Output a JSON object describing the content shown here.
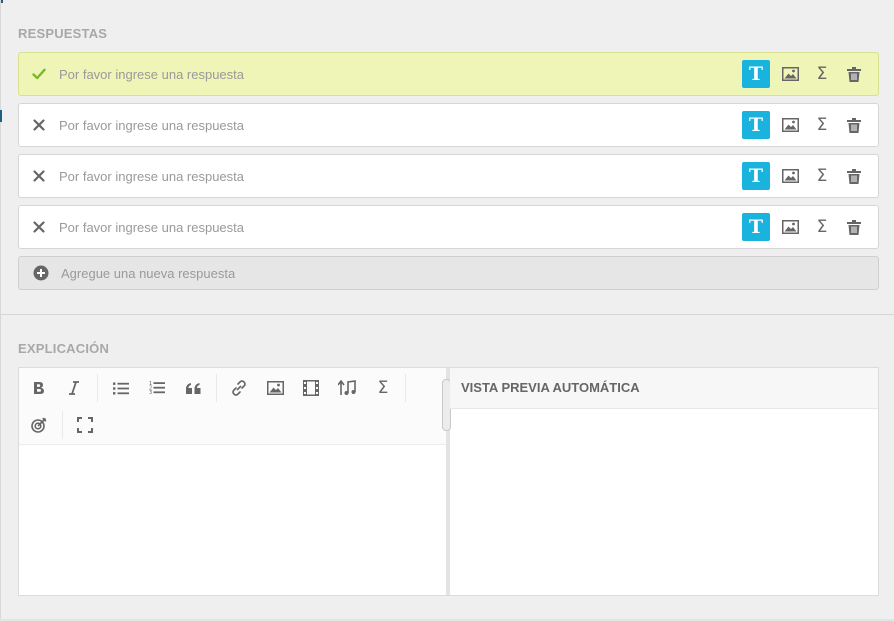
{
  "respuestas": {
    "title": "RESPUESTAS",
    "placeholder": "Por favor ingrese una respuesta",
    "items": [
      {
        "status": "correct",
        "status_icon": "check-icon",
        "text": "Por favor ingrese una respuesta"
      },
      {
        "status": "incorrect",
        "status_icon": "x-icon",
        "text": "Por favor ingrese una respuesta"
      },
      {
        "status": "incorrect",
        "status_icon": "x-icon",
        "text": "Por favor ingrese una respuesta"
      },
      {
        "status": "incorrect",
        "status_icon": "x-icon",
        "text": "Por favor ingrese una respuesta"
      }
    ],
    "tools": {
      "text_letter": "T",
      "sigma": "Σ",
      "icons": [
        "text-icon",
        "image-icon",
        "sigma-icon",
        "trash-icon"
      ]
    },
    "add_label": "Agregue una nueva respuesta"
  },
  "explicacion": {
    "title": "EXPLICACIÓN",
    "toolbar": {
      "sigma": "Σ",
      "icons": [
        "bold-icon",
        "italic-icon",
        "bullet-list-icon",
        "numbered-list-icon",
        "quote-icon",
        "link-icon",
        "image-icon",
        "video-icon",
        "audio-icon",
        "sigma-icon",
        "target-icon",
        "fullscreen-icon"
      ]
    },
    "content": "",
    "preview_title": "VISTA PREVIA AUTOMÁTICA"
  },
  "colors": {
    "accent": "#1ab3dd",
    "correct_bg": "#eef5b7",
    "check": "#7ab929",
    "background": "#efefef"
  }
}
